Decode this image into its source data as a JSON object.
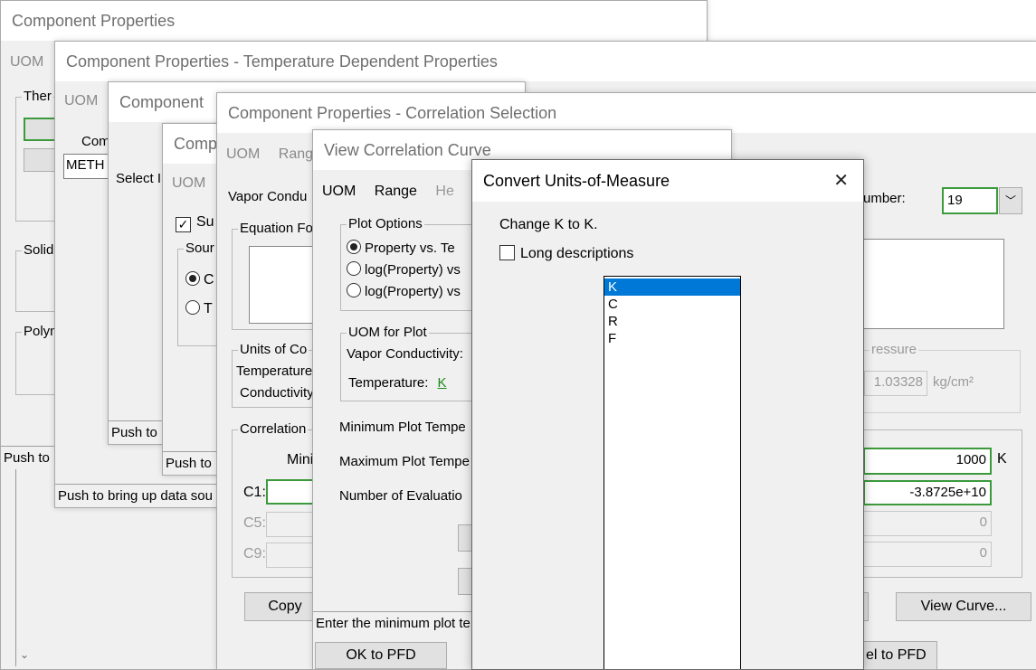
{
  "w1": {
    "title": "Component Properties",
    "menu": [
      "UOM"
    ],
    "group_thermo": "Ther",
    "group_solid": "Solid",
    "group_poly": "Polyn",
    "status": "Push to"
  },
  "w2": {
    "title": "Component Properties - Temperature Dependent Properties",
    "menu": [
      "UOM"
    ],
    "comp_label": "Com",
    "comp_value": "METH",
    "status": "Push to bring up data sou"
  },
  "w3": {
    "title": "Component",
    "menu": [
      "UOM"
    ],
    "select_label": "Select I",
    "status": "Push to"
  },
  "w4": {
    "title": "Comp",
    "menu": [
      "UOM"
    ],
    "supply_label": "Su",
    "source_label": "Sour",
    "radio1": "C",
    "radio2": "T",
    "status": "Push to"
  },
  "w5": {
    "title": "Component Properties - Correlation Selection",
    "menu": [
      "UOM",
      "Rang"
    ],
    "vapor_label": "Vapor Condu",
    "equation_label": "Equation Fo",
    "units_label": "Units of Co",
    "temperature_label": "Temperature",
    "conductivity_label": "Conductivity",
    "correlation_label": "Correlation",
    "mini_label": "Mini",
    "c1": "C1:",
    "c5": "C5:",
    "c9": "C9:",
    "copy_button": "Copy",
    "number_label": "umber:",
    "number_value": "19",
    "pressure_label": "ressure",
    "pressure_value": "1.03328",
    "pressure_unit": "kg/cm²",
    "max_value": "1000",
    "max_unit": "K",
    "c1_value": "-3.8725e+10",
    "c5_value": "0",
    "c9_value": "0",
    "view_curve_button": "View Curve...",
    "cancel_pfd_button": "el to PFD"
  },
  "w6": {
    "title": "View Correlation Curve",
    "menu": [
      "UOM",
      "Range",
      "He"
    ],
    "plot_options_label": "Plot Options",
    "plot_options": [
      "Property  vs. Te",
      "log(Property)  vs",
      "log(Property)  vs"
    ],
    "uom_plot_label": "UOM for Plot",
    "vapor_cond_label": "Vapor Conductivity:",
    "temperature_label": "Temperature:",
    "temperature_unit": "K",
    "min_plot_temp": "Minimum Plot Tempe",
    "max_plot_temp": "Maximum Plot Tempe",
    "num_eval": "Number of Evaluatio",
    "status": "Enter the minimum plot te",
    "ok_button": "OK to PFD"
  },
  "dialog": {
    "title": "Convert Units-of-Measure",
    "close_glyph": "✕",
    "change_text": "Change K to K.",
    "long_desc_label": "Long descriptions",
    "units": [
      "K",
      "C",
      "R",
      "F"
    ],
    "selected_unit": "K"
  }
}
